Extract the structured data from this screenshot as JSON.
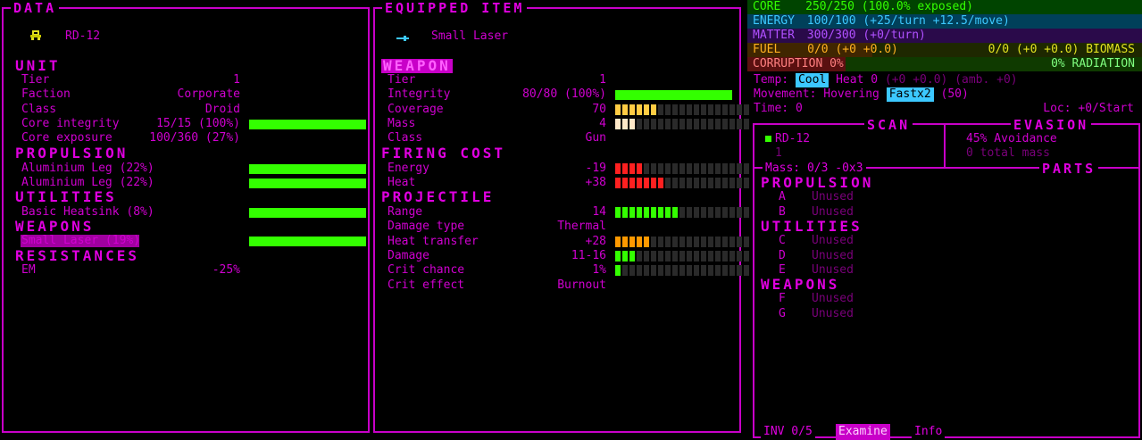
{
  "data_panel": {
    "title": "DATA",
    "unit_name": "RD-12",
    "sections": {
      "unit": "UNIT",
      "propulsion": "PROPULSION",
      "utilities": "UTILITIES",
      "weapons": "WEAPONS",
      "resistances": "RESISTANCES"
    },
    "unit_rows": [
      {
        "label": "Tier",
        "value": "1"
      },
      {
        "label": "Faction",
        "value": "Corporate"
      },
      {
        "label": "Class",
        "value": "Droid"
      },
      {
        "label": "Core integrity",
        "value": "15/15 (100%)",
        "fill": 1.0
      },
      {
        "label": "Core exposure",
        "value": "100/360 (27%)"
      }
    ],
    "propulsion_items": [
      {
        "label": "Aluminium Leg (22%)",
        "fill": 1.0
      },
      {
        "label": "Aluminium Leg (22%)",
        "fill": 1.0
      }
    ],
    "utility_items": [
      {
        "label": "Basic Heatsink (8%)",
        "fill": 1.0
      }
    ],
    "weapon_items": [
      {
        "label": "Small Laser (19%)",
        "fill": 1.0
      }
    ],
    "resistance_rows": [
      {
        "label": "EM",
        "value": "-25%"
      }
    ]
  },
  "equipped_panel": {
    "title": "EQUIPPED ITEM",
    "item_name": "Small Laser",
    "sections": {
      "weapon": "WEAPON",
      "firing_cost": "FIRING COST",
      "projectile": "PROJECTILE"
    },
    "weapon_rows": [
      {
        "label": "Tier",
        "value": "1"
      },
      {
        "label": "Integrity",
        "value": "80/80 (100%)",
        "fill": 1.0
      },
      {
        "label": "Coverage",
        "value": "70",
        "fill": 0.3,
        "color": "#ffcc44"
      },
      {
        "label": "Mass",
        "value": "4",
        "fill": 0.15,
        "color": "#ffe8c8"
      },
      {
        "label": "Class",
        "value": "Gun"
      }
    ],
    "firing_rows": [
      {
        "label": "Energy",
        "value": "-19",
        "fill": 0.2,
        "color": "#ff2020"
      },
      {
        "label": "Heat",
        "value": "+38",
        "fill": 0.38,
        "color": "#ff2020"
      }
    ],
    "projectile_rows": [
      {
        "label": "Range",
        "value": "14",
        "fill": 0.47,
        "color": "#33ff00"
      },
      {
        "label": "Damage type",
        "value": "Thermal"
      },
      {
        "label": "Heat transfer",
        "value": "+28",
        "fill": 0.28,
        "color": "#ff9900"
      },
      {
        "label": "Damage",
        "value": "11-16",
        "fill": 0.16,
        "color": "#33ff00"
      },
      {
        "label": "Crit chance",
        "value": "1%",
        "fill": 0.02,
        "color": "#33ff00"
      },
      {
        "label": "Crit effect",
        "value": "Burnout"
      }
    ]
  },
  "status": {
    "core_label": "CORE",
    "core_value": "250/250 (100.0% exposed)",
    "energy_label": "ENERGY",
    "energy_value": "100/100 (+25/turn +12.5/move)",
    "matter_label": "MATTER",
    "matter_value": "300/300 (+0/turn)",
    "fuel_label": "FUEL",
    "fuel_value": "0/0 (+0 +0.0)",
    "biomass_value": "0/0 (+0 +0.0) BIOMASS",
    "corruption_text": "CORRUPTION 0%",
    "radiation_text": "0% RADIATION",
    "temp_label": "Temp:",
    "temp_state": "Cool",
    "heat_text": "Heat 0",
    "heat_detail": "(+0 +0.0) (amb. +0)",
    "movement_label": "Movement: Hovering",
    "speed_badge": "Fastx2",
    "speed_value": "(50)",
    "time_text": "Time: 0",
    "loc_text": "Loc: +0/Start"
  },
  "scan_panel": {
    "scan_title": "SCAN",
    "evasion_title": "EVASION",
    "target_name": "RD-12",
    "target_sub": "1",
    "avoidance": "45% Avoidance",
    "total_mass": "0 total mass",
    "mass_title": "Mass: 0/3 -0x3",
    "parts_title": "PARTS",
    "groups": [
      {
        "name": "PROPULSION",
        "slots": [
          {
            "key": "A",
            "label": "Unused"
          },
          {
            "key": "B",
            "label": "Unused"
          }
        ]
      },
      {
        "name": "UTILITIES",
        "slots": [
          {
            "key": "C",
            "label": "Unused"
          },
          {
            "key": "D",
            "label": "Unused"
          },
          {
            "key": "E",
            "label": "Unused"
          }
        ]
      },
      {
        "name": "WEAPONS",
        "slots": [
          {
            "key": "F",
            "label": "Unused"
          },
          {
            "key": "G",
            "label": "Unused"
          }
        ]
      }
    ],
    "tabs": {
      "inv": "INV 0/5",
      "examine": "Examine",
      "info": "Info"
    }
  },
  "colors": {
    "accent": "#c800c8",
    "bar_full": "#33ff00",
    "core": "#33ff00",
    "energy": "#3cc8ff",
    "matter": "#b050ff",
    "fuel": "#ffb020",
    "biomass": "#e0e020",
    "corruption": "#ff2020",
    "radiation": "#33ff00"
  }
}
